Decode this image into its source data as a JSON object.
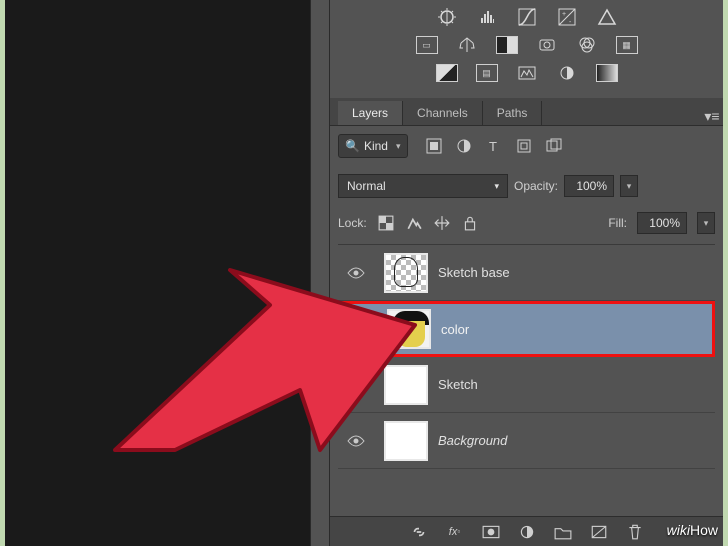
{
  "adjustments": {
    "row1": [
      "brightness-contrast",
      "levels",
      "curves",
      "exposure",
      "vibrance"
    ],
    "row2": [
      "hue-sat",
      "color-balance",
      "bw",
      "photo-filter",
      "channel-mixer",
      "color-lookup"
    ],
    "row3": [
      "invert",
      "posterize",
      "threshold",
      "selective-color",
      "gradient-map"
    ]
  },
  "tabs": [
    {
      "id": "layers",
      "label": "Layers",
      "active": true
    },
    {
      "id": "channels",
      "label": "Channels",
      "active": false
    },
    {
      "id": "paths",
      "label": "Paths",
      "active": false
    }
  ],
  "filter": {
    "kind_label": "Kind",
    "icons": [
      "pixel",
      "adjustment",
      "type",
      "shape",
      "smart-object"
    ]
  },
  "blend": {
    "mode": "Normal",
    "opacity_label": "Opacity:",
    "opacity": "100%",
    "fill_label": "Fill:",
    "fill": "100%"
  },
  "lock": {
    "label": "Lock:",
    "icons": [
      "transparency",
      "image",
      "position",
      "all"
    ]
  },
  "layers": [
    {
      "name": "Sketch base",
      "thumb": "sketch",
      "selected": false,
      "bg": false
    },
    {
      "name": "color",
      "thumb": "color",
      "selected": true,
      "bg": false
    },
    {
      "name": "Sketch",
      "thumb": "white",
      "selected": false,
      "bg": false
    },
    {
      "name": "Background",
      "thumb": "white",
      "selected": false,
      "bg": true
    }
  ],
  "bottom_icons": [
    "link",
    "fx",
    "mask",
    "fill-adjust",
    "group",
    "new-layer",
    "delete"
  ],
  "watermark": {
    "prefix": "wiki",
    "suffix": "How"
  }
}
